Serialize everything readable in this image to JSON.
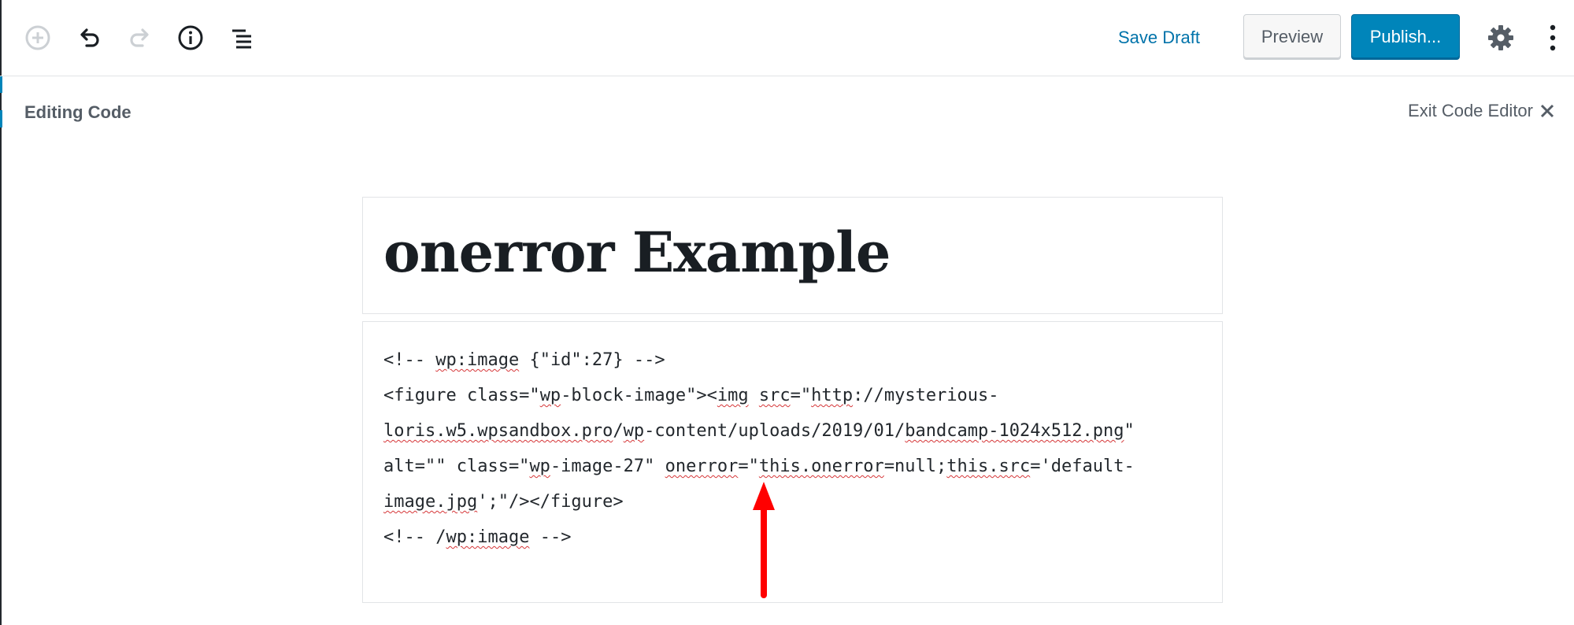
{
  "toolbar": {
    "icons": {
      "add": "plus-circle-icon",
      "undo": "undo-icon",
      "redo": "redo-icon",
      "info": "info-icon",
      "outline": "list-outline-icon",
      "settings": "gear-icon",
      "more": "vertical-ellipsis-icon"
    },
    "save_draft_label": "Save Draft",
    "preview_label": "Preview",
    "publish_label": "Publish..."
  },
  "code_editor": {
    "header_label": "Editing Code",
    "exit_label": "Exit Code Editor",
    "exit_icon": "close-icon"
  },
  "post": {
    "title": "onerror Example",
    "code_lines": {
      "line1": {
        "a": "<!-- ",
        "b": "wp:image",
        "c": " {\"id\":27} -->"
      },
      "line2": {
        "a": "<figure class=\"",
        "b": "wp",
        "c": "-block-image\"><",
        "d": "img",
        "e": " ",
        "f": "src",
        "g": "=\"",
        "h": "http",
        "i": "://mysterious-"
      },
      "line3": {
        "a": "loris.w5.wpsandbox.pro",
        "b": "/",
        "c": "wp",
        "d": "-content/uploads/2019/01/",
        "e": "bandcamp-1024x512.png",
        "f": "\""
      },
      "line4": {
        "a": "alt=\"\" class=\"",
        "b": "wp",
        "c": "-image-27\" ",
        "d": "onerror",
        "e": "=\"",
        "f": "this.onerror",
        "g": "=null;",
        "h": "this.src",
        "i": "='default-"
      },
      "line5": {
        "a": "image.jpg",
        "b": "';\"/></figure>"
      },
      "line6": {
        "a": "<!-- /",
        "b": "wp:image",
        "c": " -->"
      }
    }
  },
  "colors": {
    "accent": "#0085ba",
    "link": "#0073aa",
    "annotation_arrow": "#ff0000"
  }
}
